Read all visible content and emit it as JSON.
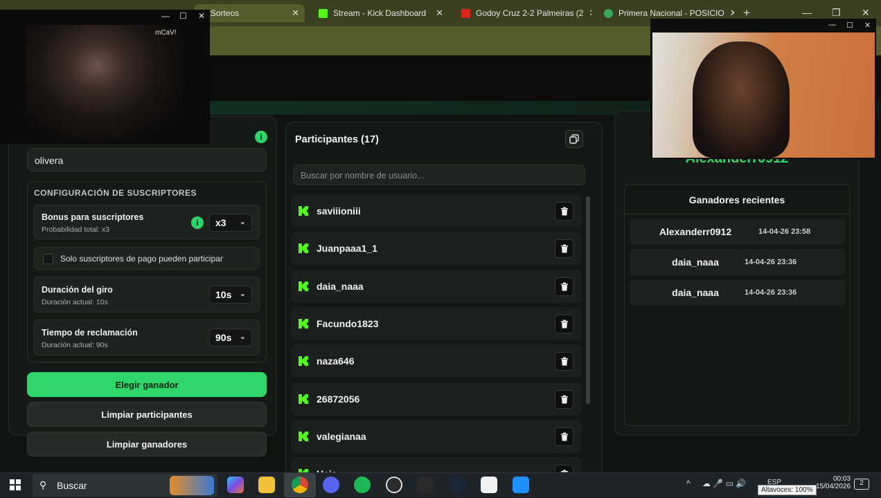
{
  "browser": {
    "tabs": [
      {
        "label": "c | Sorteos",
        "fav_color": "#2fd76a"
      },
      {
        "label": "Stream - Kick Dashboard",
        "fav_color": "#53fc18"
      },
      {
        "label": "Godoy Cruz 2-2 Palmeiras (2",
        "fav_color": "#d9261c"
      },
      {
        "label": "Primera Nacional - POSICIO",
        "fav_color": "#3aa85a"
      }
    ],
    "new_tab": "+",
    "min": "—",
    "max": "❐",
    "close": "✕"
  },
  "webcam_label": "mCaV!",
  "left": {
    "name_value": "olivera",
    "subs_title": "CONFIGURACIÓN DE SUSCRIPTORES",
    "bonus_title": "Bonus para suscriptores",
    "bonus_sub": "Probabilidad total: x3",
    "bonus_value": "x3",
    "only_paid_label": "Solo suscriptores de pago pueden participar",
    "spin_title": "Duración del giro",
    "spin_sub": "Duración actual: 10s",
    "spin_value": "10s",
    "claim_title": "Tiempo de reclamación",
    "claim_sub": "Duración actual: 90s",
    "claim_value": "90s",
    "btn_pick": "Elegir ganador",
    "btn_clear_participants": "Limpiar participantes",
    "btn_clear_winners": "Limpiar ganadores"
  },
  "participants": {
    "title": "Participantes (17)",
    "search_placeholder": "Buscar por nombre de usuario...",
    "items": [
      "saviiioniii",
      "Juanpaaa1_1",
      "daia_naaa",
      "Facundo1823",
      "naza646",
      "26872056",
      "valegianaa",
      "Haia"
    ]
  },
  "right": {
    "winner": "Alexanderr0912",
    "recent_title": "Ganadores recientes",
    "recent": [
      {
        "name": "Alexanderr0912",
        "date": "14-04-26 23:58"
      },
      {
        "name": "daia_naaa",
        "date": "14-04-26 23:36"
      },
      {
        "name": "daia_naaa",
        "date": "14-04-26 23:36"
      }
    ]
  },
  "taskbar": {
    "search_label": "Buscar",
    "time": "00:03",
    "date": "15/04/2026",
    "lang": "ESP",
    "volume": "Altavoces: 100%",
    "notif_count": "2"
  },
  "colors": {
    "accent": "#2fd76a",
    "kick": "#53fc18"
  }
}
